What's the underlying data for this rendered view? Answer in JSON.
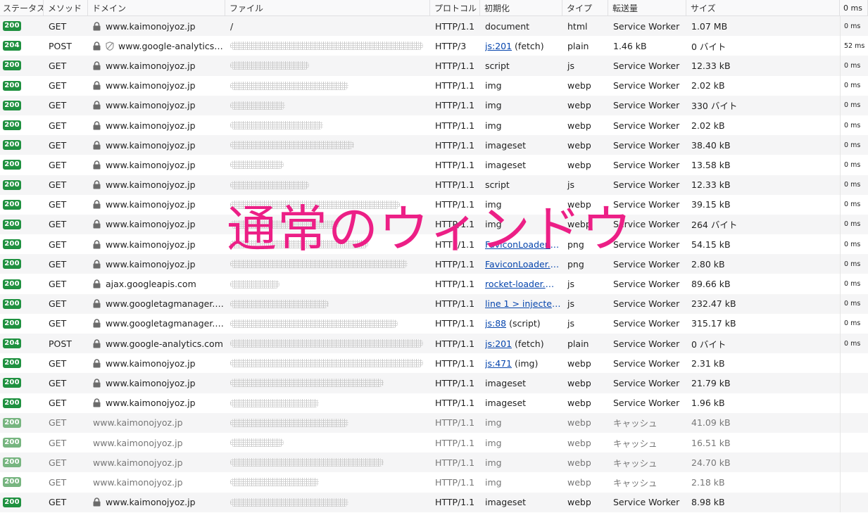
{
  "header": {
    "status": "ステータス",
    "method": "メソッド",
    "domain": "ドメイン",
    "file": "ファイル",
    "protocol": "プロトコル",
    "initiator": "初期化",
    "type": "タイプ",
    "transferred": "転送量",
    "size": "サイズ",
    "time": "0 ms"
  },
  "overlay_text": "通常のウィンドウ",
  "rows": [
    {
      "status": "200",
      "method": "GET",
      "domain": "www.kaimonojyoz.jp",
      "file": "/",
      "file_w": 0,
      "protocol": "HTTP/1.1",
      "initiator": "document",
      "initiator_link": "",
      "initiator_suffix": "",
      "type": "html",
      "transferred": "Service Worker",
      "size": "1.07 MB",
      "time": "0 ms",
      "lock": true,
      "tracker": false,
      "cached": false
    },
    {
      "status": "204",
      "method": "POST",
      "domain": "www.google-analytics.c...",
      "file": "",
      "file_w": 0.98,
      "protocol": "HTTP/3",
      "initiator": "",
      "initiator_link": "js:201",
      "initiator_suffix": " (fetch)",
      "type": "plain",
      "transferred": "1.46 kB",
      "size": "0 バイト",
      "time": "52 ms",
      "lock": true,
      "tracker": true,
      "cached": false
    },
    {
      "status": "200",
      "method": "GET",
      "domain": "www.kaimonojyoz.jp",
      "file": "",
      "file_w": 0.4,
      "protocol": "HTTP/1.1",
      "initiator": "script",
      "initiator_link": "",
      "initiator_suffix": "",
      "type": "js",
      "transferred": "Service Worker",
      "size": "12.33 kB",
      "time": "0 ms",
      "lock": true,
      "tracker": false,
      "cached": false
    },
    {
      "status": "200",
      "method": "GET",
      "domain": "www.kaimonojyoz.jp",
      "file": "",
      "file_w": 0.6,
      "protocol": "HTTP/1.1",
      "initiator": "img",
      "initiator_link": "",
      "initiator_suffix": "",
      "type": "webp",
      "transferred": "Service Worker",
      "size": "2.02 kB",
      "time": "0 ms",
      "lock": true,
      "tracker": false,
      "cached": false
    },
    {
      "status": "200",
      "method": "GET",
      "domain": "www.kaimonojyoz.jp",
      "file": "",
      "file_w": 0.28,
      "protocol": "HTTP/1.1",
      "initiator": "img",
      "initiator_link": "",
      "initiator_suffix": "",
      "type": "webp",
      "transferred": "Service Worker",
      "size": "330 バイト",
      "time": "0 ms",
      "lock": true,
      "tracker": false,
      "cached": false
    },
    {
      "status": "200",
      "method": "GET",
      "domain": "www.kaimonojyoz.jp",
      "file": "",
      "file_w": 0.47,
      "protocol": "HTTP/1.1",
      "initiator": "img",
      "initiator_link": "",
      "initiator_suffix": "",
      "type": "webp",
      "transferred": "Service Worker",
      "size": "2.02 kB",
      "time": "0 ms",
      "lock": true,
      "tracker": false,
      "cached": false
    },
    {
      "status": "200",
      "method": "GET",
      "domain": "www.kaimonojyoz.jp",
      "file": "",
      "file_w": 0.63,
      "protocol": "HTTP/1.1",
      "initiator": "imageset",
      "initiator_link": "",
      "initiator_suffix": "",
      "type": "webp",
      "transferred": "Service Worker",
      "size": "38.40 kB",
      "time": "0 ms",
      "lock": true,
      "tracker": false,
      "cached": false
    },
    {
      "status": "200",
      "method": "GET",
      "domain": "www.kaimonojyoz.jp",
      "file": "",
      "file_w": 0.27,
      "protocol": "HTTP/1.1",
      "initiator": "imageset",
      "initiator_link": "",
      "initiator_suffix": "",
      "type": "webp",
      "transferred": "Service Worker",
      "size": "13.58 kB",
      "time": "0 ms",
      "lock": true,
      "tracker": false,
      "cached": false
    },
    {
      "status": "200",
      "method": "GET",
      "domain": "www.kaimonojyoz.jp",
      "file": "",
      "file_w": 0.4,
      "protocol": "HTTP/1.1",
      "initiator": "script",
      "initiator_link": "",
      "initiator_suffix": "",
      "type": "js",
      "transferred": "Service Worker",
      "size": "12.33 kB",
      "time": "0 ms",
      "lock": true,
      "tracker": false,
      "cached": false
    },
    {
      "status": "200",
      "method": "GET",
      "domain": "www.kaimonojyoz.jp",
      "file": "",
      "file_w": 0.86,
      "protocol": "HTTP/1.1",
      "initiator": "img",
      "initiator_link": "",
      "initiator_suffix": "",
      "type": "webp",
      "transferred": "Service Worker",
      "size": "39.15 kB",
      "time": "0 ms",
      "lock": true,
      "tracker": false,
      "cached": false
    },
    {
      "status": "200",
      "method": "GET",
      "domain": "www.kaimonojyoz.jp",
      "file": "",
      "file_w": 0.55,
      "protocol": "HTTP/1.1",
      "initiator": "img",
      "initiator_link": "",
      "initiator_suffix": "",
      "type": "webp",
      "transferred": "Service Worker",
      "size": "264 バイト",
      "time": "0 ms",
      "lock": true,
      "tracker": false,
      "cached": false
    },
    {
      "status": "200",
      "method": "GET",
      "domain": "www.kaimonojyoz.jp",
      "file": "",
      "file_w": 0.7,
      "protocol": "HTTP/1.1",
      "initiator": "",
      "initiator_link": "FaviconLoader.sy...",
      "initiator_suffix": "",
      "type": "png",
      "transferred": "Service Worker",
      "size": "54.15 kB",
      "time": "0 ms",
      "lock": true,
      "tracker": false,
      "cached": false
    },
    {
      "status": "200",
      "method": "GET",
      "domain": "www.kaimonojyoz.jp",
      "file": "",
      "file_w": 0.9,
      "protocol": "HTTP/1.1",
      "initiator": "",
      "initiator_link": "FaviconLoader.sy...",
      "initiator_suffix": "",
      "type": "png",
      "transferred": "Service Worker",
      "size": "2.80 kB",
      "time": "0 ms",
      "lock": true,
      "tracker": false,
      "cached": false
    },
    {
      "status": "200",
      "method": "GET",
      "domain": "ajax.googleapis.com",
      "file": "",
      "file_w": 0.25,
      "protocol": "HTTP/1.1",
      "initiator": "",
      "initiator_link": "rocket-loader.mi...",
      "initiator_suffix": "",
      "type": "js",
      "transferred": "Service Worker",
      "size": "89.66 kB",
      "time": "0 ms",
      "lock": true,
      "tracker": false,
      "cached": false
    },
    {
      "status": "200",
      "method": "GET",
      "domain": "www.googletagmanager.co...",
      "file": "",
      "file_w": 0.5,
      "protocol": "HTTP/1.1",
      "initiator": "",
      "initiator_link": "line 1 > injected...",
      "initiator_suffix": "",
      "type": "js",
      "transferred": "Service Worker",
      "size": "232.47 kB",
      "time": "0 ms",
      "lock": true,
      "tracker": false,
      "cached": false
    },
    {
      "status": "200",
      "method": "GET",
      "domain": "www.googletagmanager.co...",
      "file": "",
      "file_w": 0.85,
      "protocol": "HTTP/1.1",
      "initiator": "",
      "initiator_link": "js:88",
      "initiator_suffix": " (script)",
      "type": "js",
      "transferred": "Service Worker",
      "size": "315.17 kB",
      "time": "0 ms",
      "lock": true,
      "tracker": false,
      "cached": false
    },
    {
      "status": "204",
      "method": "POST",
      "domain": "www.google-analytics.com",
      "file": "",
      "file_w": 0.98,
      "protocol": "HTTP/1.1",
      "initiator": "",
      "initiator_link": "js:201",
      "initiator_suffix": " (fetch)",
      "type": "plain",
      "transferred": "Service Worker",
      "size": "0 バイト",
      "time": "0 ms",
      "lock": true,
      "tracker": false,
      "cached": false
    },
    {
      "status": "200",
      "method": "GET",
      "domain": "www.kaimonojyoz.jp",
      "file": "",
      "file_w": 0.98,
      "protocol": "HTTP/1.1",
      "initiator": "",
      "initiator_link": "js:471",
      "initiator_suffix": " (img)",
      "type": "webp",
      "transferred": "Service Worker",
      "size": "2.31 kB",
      "time": "",
      "lock": true,
      "tracker": false,
      "cached": false
    },
    {
      "status": "200",
      "method": "GET",
      "domain": "www.kaimonojyoz.jp",
      "file": "",
      "file_w": 0.78,
      "protocol": "HTTP/1.1",
      "initiator": "imageset",
      "initiator_link": "",
      "initiator_suffix": "",
      "type": "webp",
      "transferred": "Service Worker",
      "size": "21.79 kB",
      "time": "",
      "lock": true,
      "tracker": false,
      "cached": false
    },
    {
      "status": "200",
      "method": "GET",
      "domain": "www.kaimonojyoz.jp",
      "file": "",
      "file_w": 0.45,
      "protocol": "HTTP/1.1",
      "initiator": "imageset",
      "initiator_link": "",
      "initiator_suffix": "",
      "type": "webp",
      "transferred": "Service Worker",
      "size": "1.96 kB",
      "time": "",
      "lock": true,
      "tracker": false,
      "cached": false
    },
    {
      "status": "200",
      "method": "GET",
      "domain": "www.kaimonojyoz.jp",
      "file": "",
      "file_w": 0.6,
      "protocol": "HTTP/1.1",
      "initiator": "img",
      "initiator_link": "",
      "initiator_suffix": "",
      "type": "webp",
      "transferred": "キャッシュ",
      "size": "41.09 kB",
      "time": "",
      "lock": false,
      "tracker": false,
      "cached": true
    },
    {
      "status": "200",
      "method": "GET",
      "domain": "www.kaimonojyoz.jp",
      "file": "",
      "file_w": 0.27,
      "protocol": "HTTP/1.1",
      "initiator": "img",
      "initiator_link": "",
      "initiator_suffix": "",
      "type": "webp",
      "transferred": "キャッシュ",
      "size": "16.51 kB",
      "time": "",
      "lock": false,
      "tracker": false,
      "cached": true
    },
    {
      "status": "200",
      "method": "GET",
      "domain": "www.kaimonojyoz.jp",
      "file": "",
      "file_w": 0.78,
      "protocol": "HTTP/1.1",
      "initiator": "img",
      "initiator_link": "",
      "initiator_suffix": "",
      "type": "webp",
      "transferred": "キャッシュ",
      "size": "24.70 kB",
      "time": "",
      "lock": false,
      "tracker": false,
      "cached": true
    },
    {
      "status": "200",
      "method": "GET",
      "domain": "www.kaimonojyoz.jp",
      "file": "",
      "file_w": 0.45,
      "protocol": "HTTP/1.1",
      "initiator": "img",
      "initiator_link": "",
      "initiator_suffix": "",
      "type": "webp",
      "transferred": "キャッシュ",
      "size": "2.18 kB",
      "time": "",
      "lock": false,
      "tracker": false,
      "cached": true
    },
    {
      "status": "200",
      "method": "GET",
      "domain": "www.kaimonojyoz.jp",
      "file": "",
      "file_w": 0.6,
      "protocol": "HTTP/1.1",
      "initiator": "imageset",
      "initiator_link": "",
      "initiator_suffix": "",
      "type": "webp",
      "transferred": "Service Worker",
      "size": "8.98 kB",
      "time": "",
      "lock": true,
      "tracker": false,
      "cached": false
    }
  ]
}
